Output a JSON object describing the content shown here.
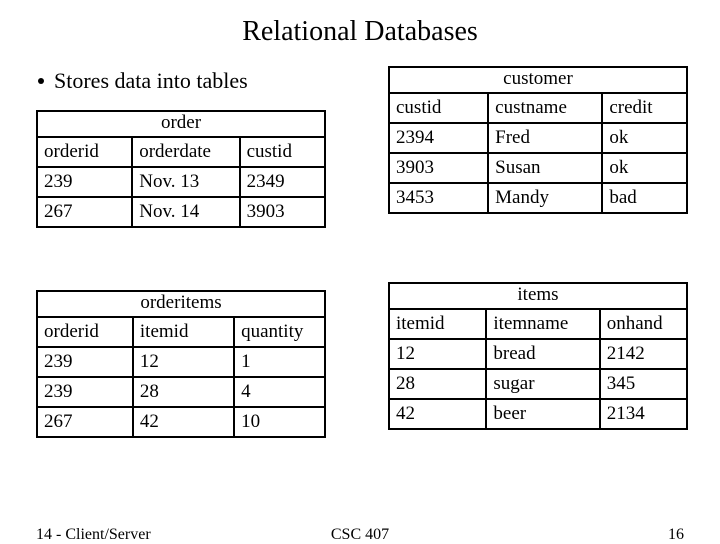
{
  "title": "Relational Databases",
  "bullet": "Stores data into tables",
  "tables": {
    "order": {
      "caption": "order",
      "headers": [
        "orderid",
        "orderdate",
        "custid"
      ],
      "rows": [
        [
          "239",
          "Nov. 13",
          "2349"
        ],
        [
          "267",
          "Nov. 14",
          "3903"
        ]
      ]
    },
    "customer": {
      "caption": "customer",
      "headers": [
        "custid",
        "custname",
        "credit"
      ],
      "rows": [
        [
          "2394",
          "Fred",
          "ok"
        ],
        [
          "3903",
          "Susan",
          "ok"
        ],
        [
          "3453",
          "Mandy",
          "bad"
        ]
      ]
    },
    "orderitems": {
      "caption": "orderitems",
      "headers": [
        "orderid",
        "itemid",
        "quantity"
      ],
      "rows": [
        [
          "239",
          "12",
          "1"
        ],
        [
          "239",
          "28",
          "4"
        ],
        [
          "267",
          "42",
          "10"
        ]
      ]
    },
    "items": {
      "caption": "items",
      "headers": [
        "itemid",
        "itemname",
        "onhand"
      ],
      "rows": [
        [
          "12",
          "bread",
          "2142"
        ],
        [
          "28",
          "sugar",
          "345"
        ],
        [
          "42",
          "beer",
          "2134"
        ]
      ]
    }
  },
  "footer": {
    "left": "14 - Client/Server",
    "center": "CSC 407",
    "right": "16"
  }
}
